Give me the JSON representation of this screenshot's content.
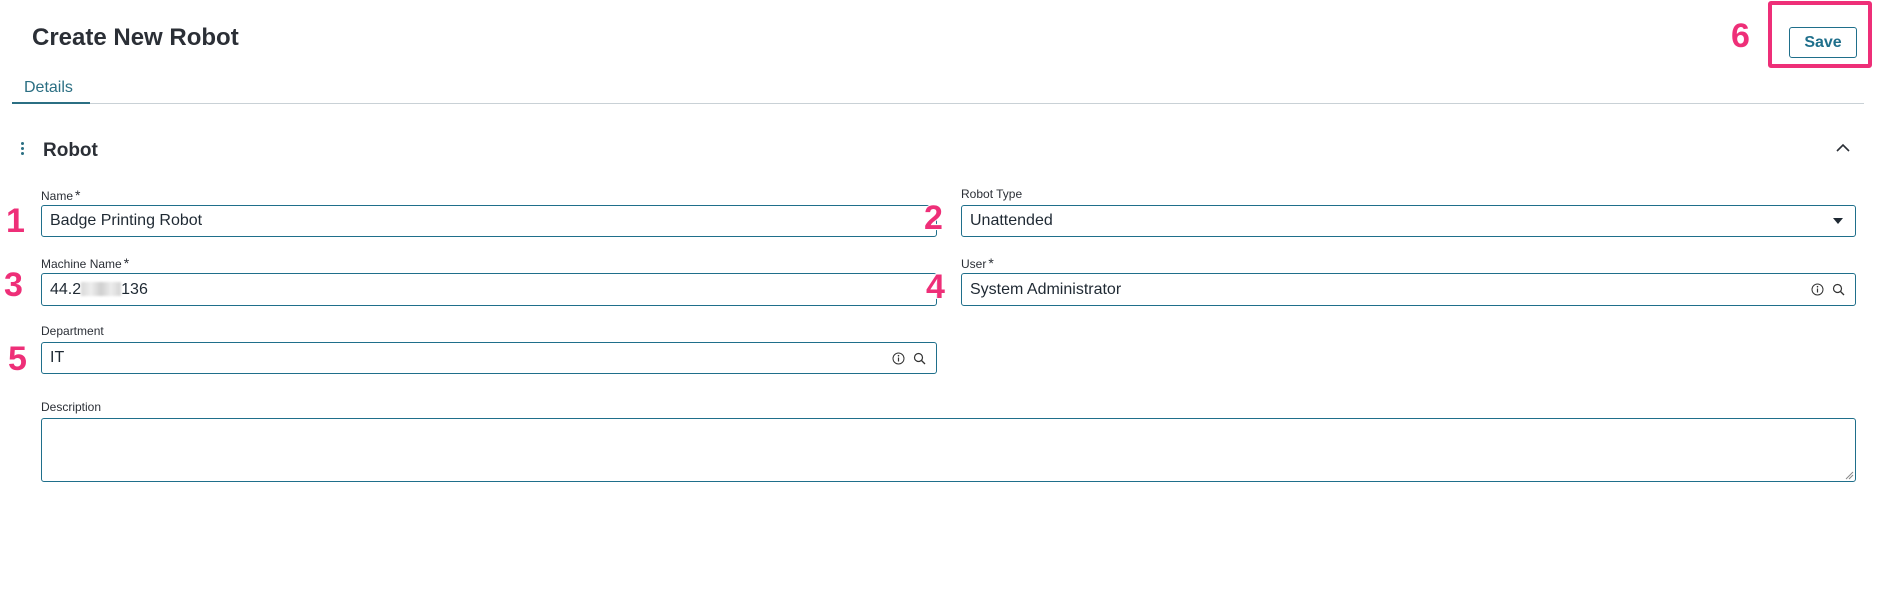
{
  "page": {
    "title": "Create New Robot"
  },
  "tabs": [
    {
      "label": "Details",
      "active": true
    }
  ],
  "toolbar": {
    "save_label": "Save"
  },
  "section": {
    "title": "Robot"
  },
  "fields": {
    "name": {
      "label": "Name",
      "required": "*",
      "value": "Badge Printing Robot"
    },
    "robot_type": {
      "label": "Robot Type",
      "value": "Unattended"
    },
    "machine_name": {
      "label": "Machine Name",
      "required": "*",
      "value_prefix": "44.2",
      "value_suffix": "136"
    },
    "user": {
      "label": "User",
      "required": "*",
      "value": "System Administrator"
    },
    "department": {
      "label": "Department",
      "value": "IT"
    },
    "description": {
      "label": "Description",
      "value": ""
    }
  },
  "callouts": [
    "1",
    "2",
    "3",
    "4",
    "5",
    "6"
  ],
  "colors": {
    "accent": "#1f6f8b",
    "callout": "#ee2f78"
  },
  "icons": {
    "info": "info-icon",
    "search": "search-icon",
    "collapse": "chevron-up-icon",
    "dropdown": "caret-down-icon",
    "menu": "vertical-dots-icon"
  }
}
